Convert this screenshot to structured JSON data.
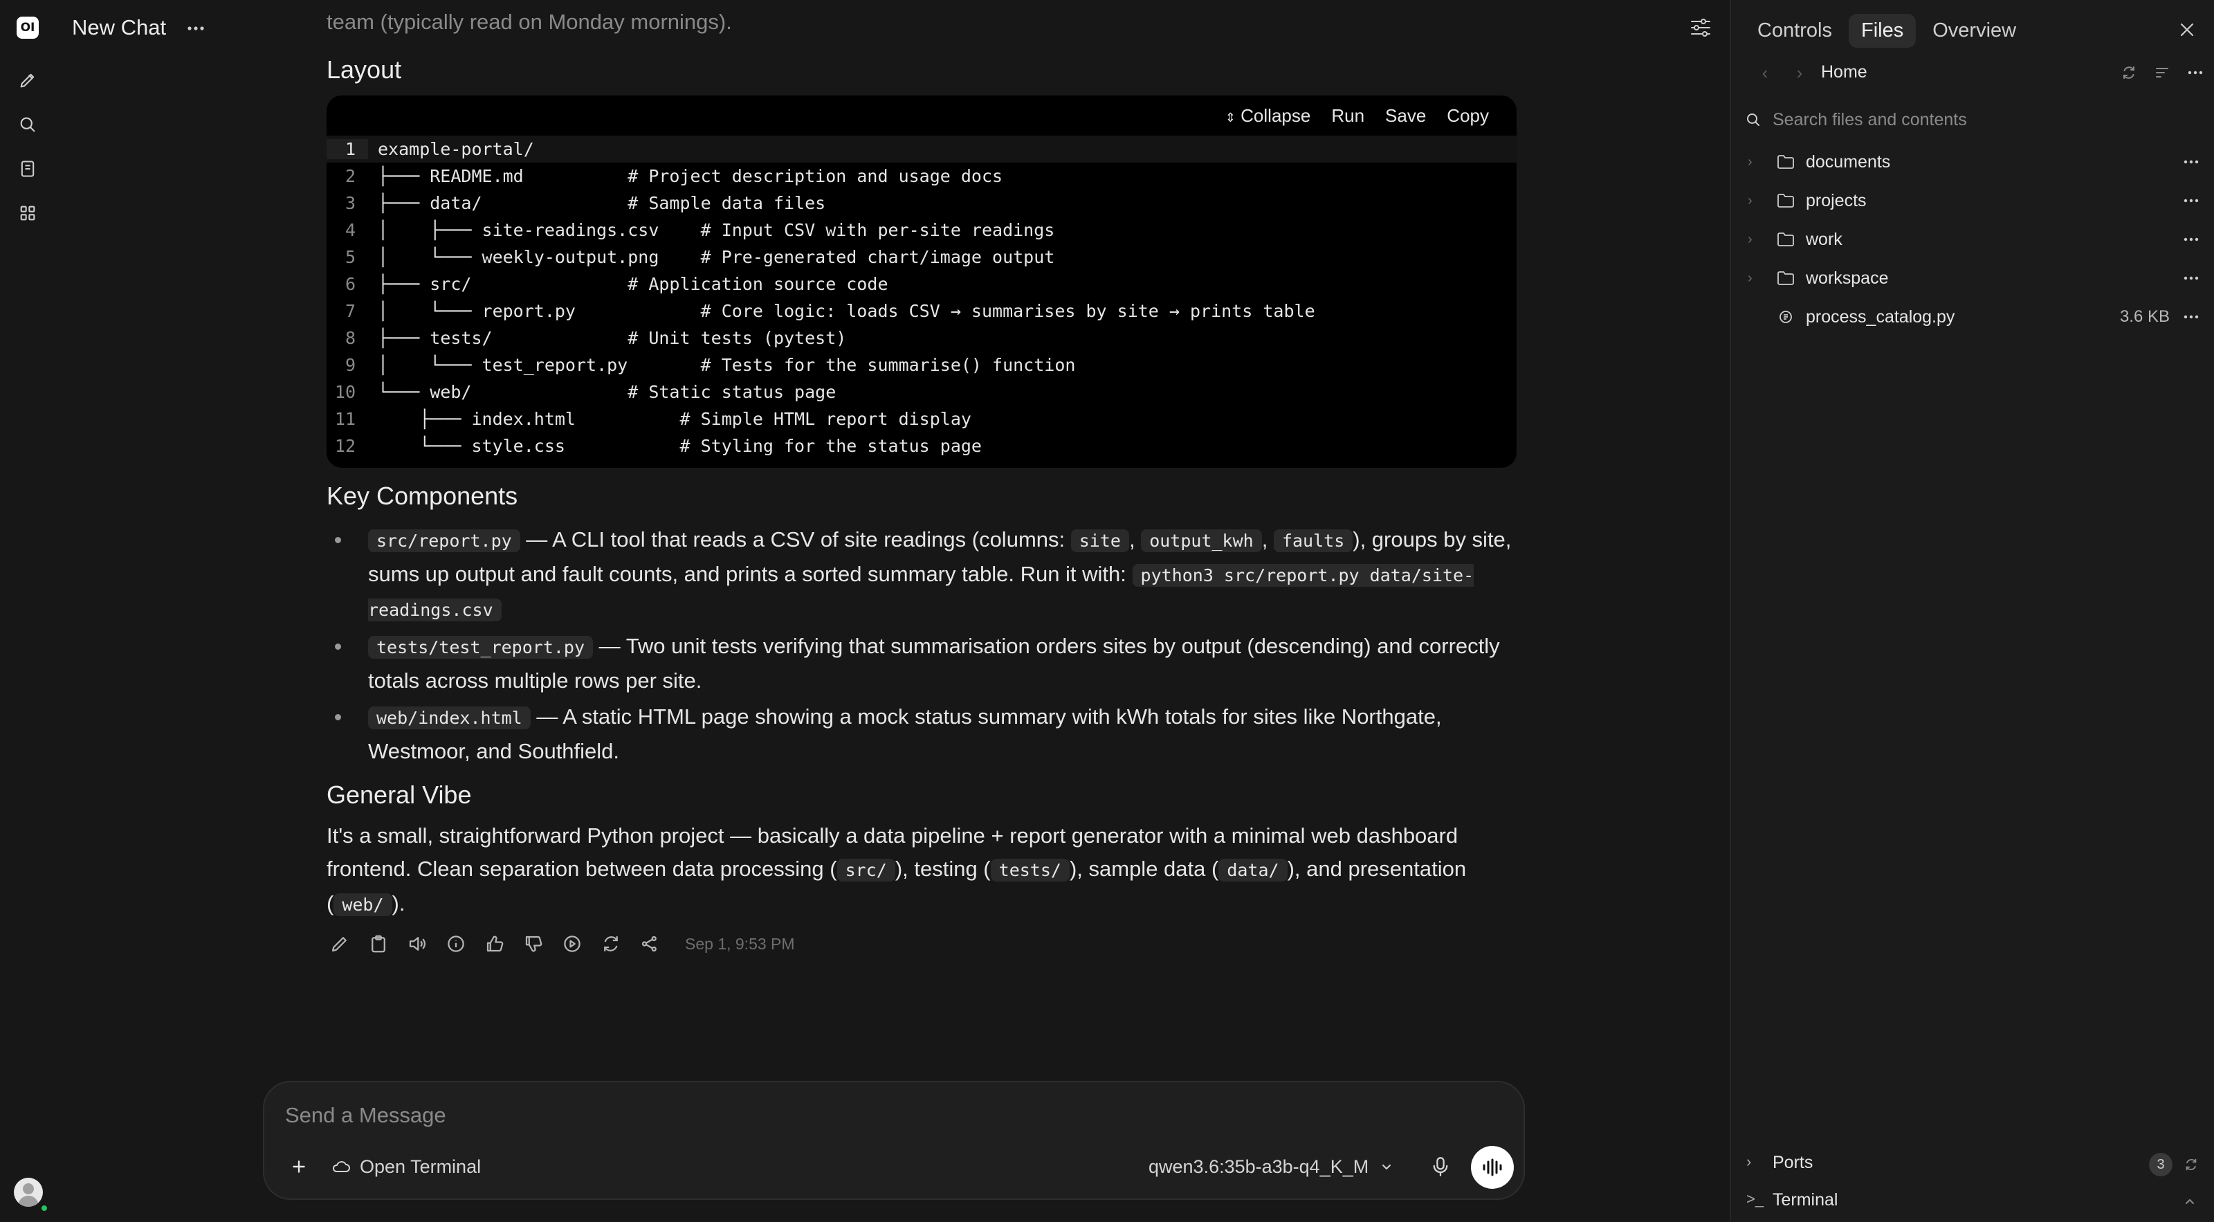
{
  "app": {
    "logo_text": "OI",
    "chat_title": "New Chat"
  },
  "message": {
    "faded_line": "team (typically read on Monday mornings).",
    "layout_heading": "Layout",
    "code_toolbar": {
      "collapse": "Collapse",
      "run": "Run",
      "save": "Save",
      "copy": "Copy"
    },
    "code_lines": [
      {
        "n": "1",
        "t": "example-portal/"
      },
      {
        "n": "2",
        "t": "├─── README.md          # Project description and usage docs"
      },
      {
        "n": "3",
        "t": "├─── data/              # Sample data files"
      },
      {
        "n": "4",
        "t": "│    ├─── site-readings.csv    # Input CSV with per-site readings"
      },
      {
        "n": "5",
        "t": "│    └─── weekly-output.png    # Pre-generated chart/image output"
      },
      {
        "n": "6",
        "t": "├─── src/               # Application source code"
      },
      {
        "n": "7",
        "t": "│    └─── report.py            # Core logic: loads CSV → summarises by site → prints table"
      },
      {
        "n": "8",
        "t": "├─── tests/             # Unit tests (pytest)"
      },
      {
        "n": "9",
        "t": "│    └─── test_report.py       # Tests for the summarise() function"
      },
      {
        "n": "10",
        "t": "└─── web/               # Static status page"
      },
      {
        "n": "11",
        "t": "    ├─── index.html          # Simple HTML report display"
      },
      {
        "n": "12",
        "t": "    └─── style.css           # Styling for the status page"
      }
    ],
    "key_heading": "Key Components",
    "bullets": {
      "b1_code": "src/report.py",
      "b1_t1": " — A CLI tool that reads a CSV of site readings (columns: ",
      "b1_c2": "site",
      "b1_sep1": ", ",
      "b1_c3": "output_kwh",
      "b1_sep2": ", ",
      "b1_c4": "faults",
      "b1_t2": "), groups by site, sums up output and fault counts, and prints a sorted summary table. Run it with: ",
      "b1_c5": "python3 src/report.py data/site-readings.csv",
      "b2_code": "tests/test_report.py",
      "b2_t1": " — Two unit tests verifying that summarisation orders sites by output (descending) and correctly totals across multiple rows per site.",
      "b3_code": "web/index.html",
      "b3_t1": " — A static HTML page showing a mock status summary with kWh totals for sites like Northgate, Westmoor, and Southfield."
    },
    "vibe_heading": "General Vibe",
    "vibe": {
      "t1": "It's a small, straightforward Python project — basically a data pipeline + report generator with a minimal web dashboard frontend. Clean separation between data processing (",
      "c1": "src/",
      "t2": "), testing (",
      "c2": "tests/",
      "t3": "), sample data (",
      "c3": "data/",
      "t4": "), and presentation (",
      "c4": "web/",
      "t5": ")."
    },
    "timestamp": "Sep 1, 9:53 PM"
  },
  "composer": {
    "placeholder": "Send a Message",
    "open_terminal": "Open Terminal",
    "model": "qwen3.6:35b-a3b-q4_K_M"
  },
  "panel": {
    "tabs": [
      "Controls",
      "Files",
      "Overview"
    ],
    "active_tab": "Files",
    "breadcrumb": "Home",
    "search_placeholder": "Search files and contents",
    "items": [
      {
        "name": "documents",
        "type": "folder",
        "size": ""
      },
      {
        "name": "projects",
        "type": "folder",
        "size": ""
      },
      {
        "name": "work",
        "type": "folder",
        "size": ""
      },
      {
        "name": "workspace",
        "type": "folder",
        "size": ""
      },
      {
        "name": "process_catalog.py",
        "type": "file",
        "size": "3.6 KB"
      }
    ],
    "ports_label": "Ports",
    "ports_count": "3",
    "terminal_label": "Terminal"
  }
}
